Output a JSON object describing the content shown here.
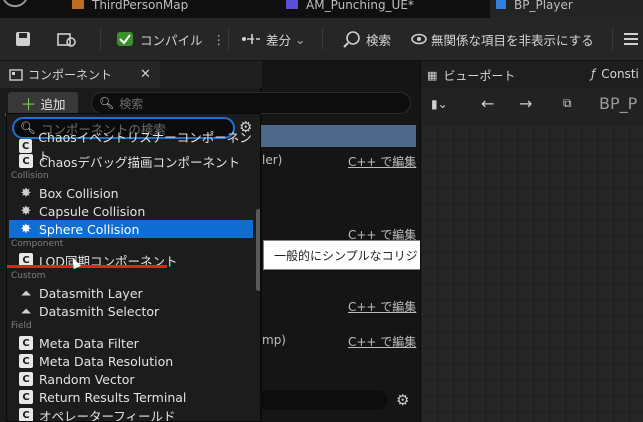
{
  "tabs": [
    {
      "label": "ThirdPersonMap"
    },
    {
      "label": "AM_Punching_UE*"
    },
    {
      "label": "BP_Player"
    }
  ],
  "toolbar": {
    "compile": "コンパイル",
    "diff": "差分",
    "search": "検索",
    "hide_unrelated": "無関係な項目を非表示にする"
  },
  "panel": {
    "title": "コンポーネント",
    "add": "追加",
    "search_placeholder": "検索"
  },
  "dropdown": {
    "search_placeholder": "コンポーネントの検索",
    "items": [
      {
        "label": "Chaosイベントリスナーコンポーネント"
      },
      {
        "label": "Chaosデバッグ描画コンポーネント"
      }
    ],
    "cat_collision": "Collision",
    "collision_items": [
      {
        "label": "Box Collision"
      },
      {
        "label": "Capsule Collision"
      },
      {
        "label": "Sphere Collision"
      }
    ],
    "cat_component": "Component",
    "component_items": [
      {
        "label": "LOD同期コンポーネント"
      }
    ],
    "cat_custom": "Custom",
    "custom_items": [
      {
        "label": "Datasmith Layer"
      },
      {
        "label": "Datasmith Selector"
      }
    ],
    "cat_field": "Field",
    "field_items": [
      {
        "label": "Meta Data Filter"
      },
      {
        "label": "Meta Data Resolution"
      },
      {
        "label": "Random Vector"
      },
      {
        "label": "Return Results Terminal"
      },
      {
        "label": "オペレーターフィールド"
      }
    ]
  },
  "background": {
    "ler": "ler)",
    "edit_cpp": "C++ で編集",
    "mp": "mp)"
  },
  "tooltip": "一般的にシンプルなコリジョンに使用する球体です。バウンドはエディタで",
  "right": {
    "viewport": "ビューポート",
    "construction": "Consti",
    "bp_name": "BP_P"
  }
}
